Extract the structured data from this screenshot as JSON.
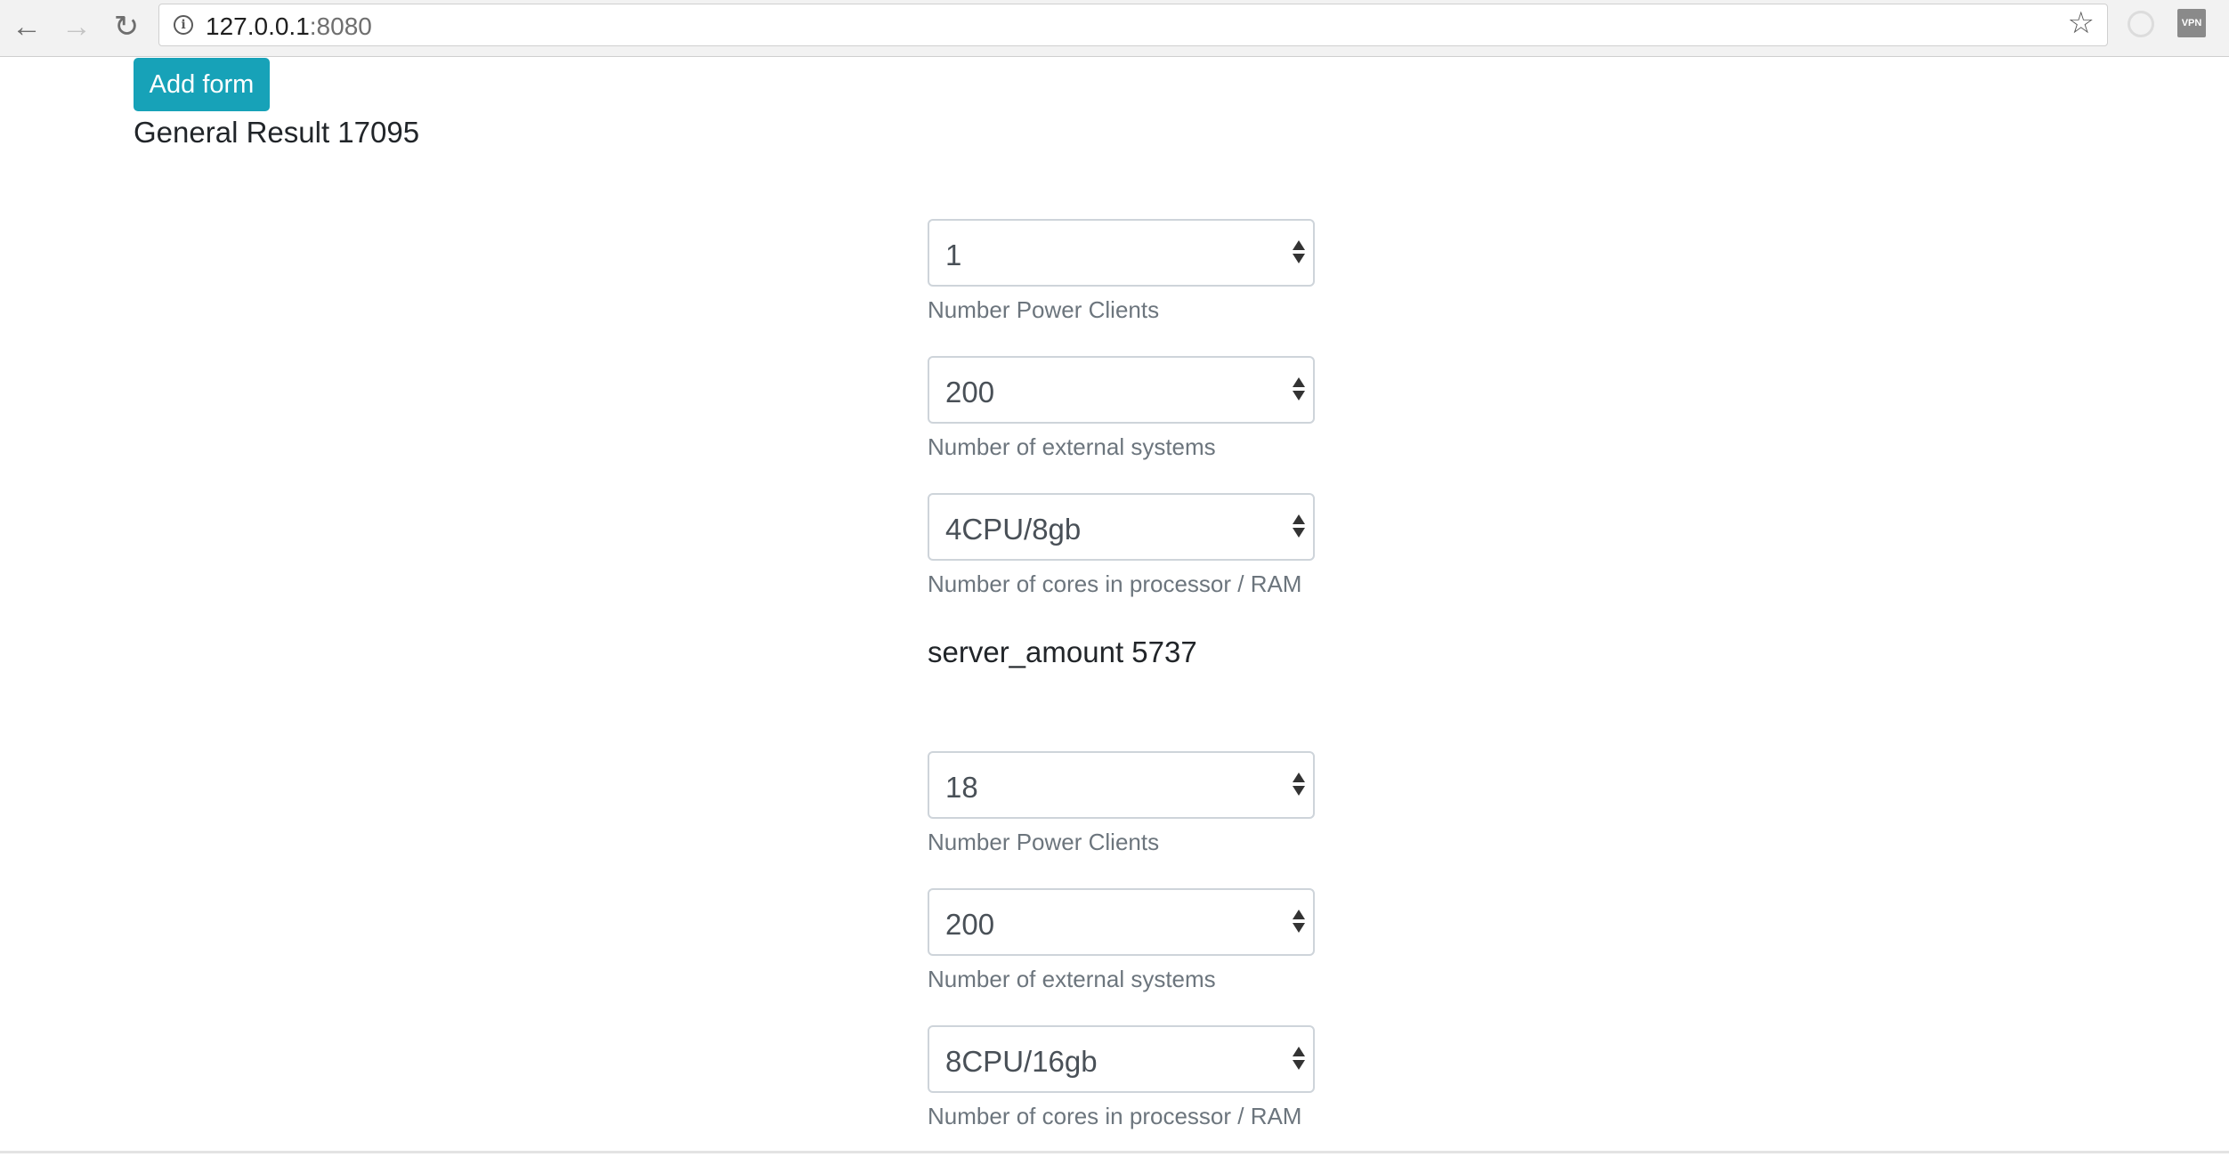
{
  "browser": {
    "url_host": "127.0.0.1",
    "url_port": ":8080",
    "icons": {
      "back": "arrow-left-icon",
      "forward": "arrow-right-icon",
      "reload": "reload-icon",
      "info": "info-icon",
      "bookmark": "star-icon",
      "extension": "extension-icon",
      "vpn": "vpn-icon"
    },
    "vpn_label": "VPN"
  },
  "page": {
    "add_form_label": "Add form",
    "general_result": "General Result 17095",
    "accent_color": "#17a2b8",
    "forms": [
      {
        "power_clients": "1",
        "power_clients_help": "Number Power Clients",
        "external_systems": "200",
        "external_systems_help": "Number of external systems",
        "cores_ram": "4CPU/8gb",
        "cores_ram_help": "Number of cores in processor / RAM",
        "server_amount": "server_amount 5737"
      },
      {
        "power_clients": "18",
        "power_clients_help": "Number Power Clients",
        "external_systems": "200",
        "external_systems_help": "Number of external systems",
        "cores_ram": "8CPU/16gb",
        "cores_ram_help": "Number of cores in processor / RAM"
      }
    ]
  }
}
